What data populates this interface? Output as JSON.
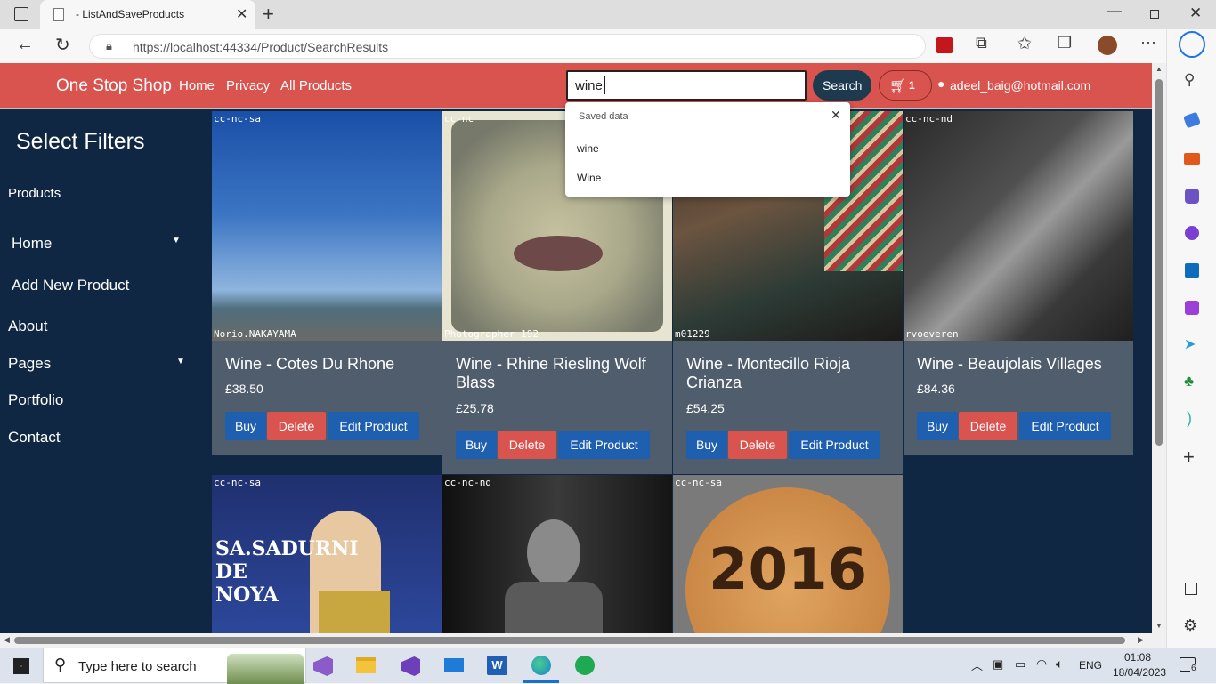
{
  "browser": {
    "tab_title": "- ListAndSaveProducts",
    "url": "https://localhost:44334/Product/SearchResults"
  },
  "navbar": {
    "brand": "One Stop Shop",
    "links": [
      "Home",
      "Privacy",
      "All Products"
    ],
    "search_value": "wine",
    "search_button": "Search",
    "cart_count": "1",
    "user_email": "adeel_baig@hotmail.com"
  },
  "autocomplete": {
    "header": "Saved data",
    "items": [
      "wine",
      "Wine"
    ]
  },
  "sidebar": {
    "title": "Select Filters",
    "items": [
      "Products",
      "Home",
      "Add New Product",
      "About",
      "Pages",
      "Portfolio",
      "Contact"
    ]
  },
  "products": [
    {
      "title": "Wine - Cotes Du Rhone",
      "price": "£38.50",
      "license": "cc-nc-sa",
      "credit": "Norio.NAKAYAMA"
    },
    {
      "title": "Wine - Rhine Riesling Wolf Blass",
      "price": "£25.78",
      "license": "cc-nc",
      "credit": "Photographer 192"
    },
    {
      "title": "Wine - Montecillo Rioja Crianza",
      "price": "£54.25",
      "license": "",
      "credit": "m01229"
    },
    {
      "title": "Wine - Beaujolais Villages",
      "price": "£84.36",
      "license": "cc-nc-nd",
      "credit": "rvoeveren"
    },
    {
      "license": "cc-nc-sa",
      "poster_text": "SA.SADURNI DE NOYA"
    },
    {
      "license": "cc-nc-nd"
    },
    {
      "license": "cc-nc-sa",
      "cork_text": "2016"
    }
  ],
  "buttons": {
    "buy": "Buy",
    "delete": "Delete",
    "edit": "Edit Product"
  },
  "taskbar": {
    "search_placeholder": "Type here to search",
    "lang": "ENG",
    "time": "01:08",
    "date": "18/04/2023",
    "notifications": "6"
  },
  "colors": {
    "navbar": "#d9534f",
    "page_bg": "#0f2742",
    "card": "#505d6d",
    "buy": "#1f5fb0",
    "delete": "#d9534f"
  }
}
